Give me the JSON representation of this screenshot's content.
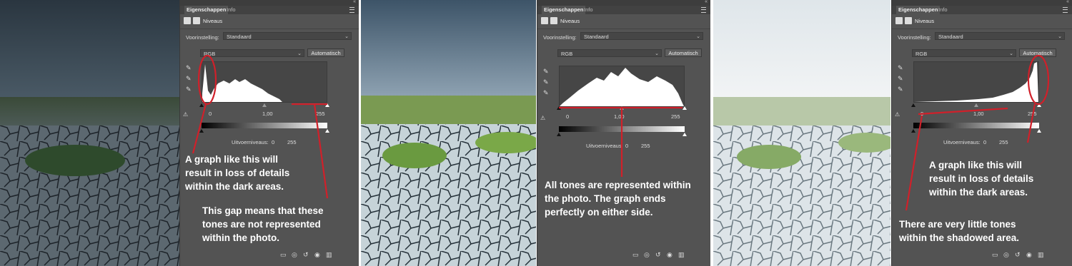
{
  "panels": [
    {
      "tabs": {
        "active": "Eigenschappen",
        "inactive": "Info"
      },
      "adjustment_title": "Niveaus",
      "preset_label": "Voorinstelling:",
      "preset_value": "Standaard",
      "channel_value": "RGB",
      "auto_label": "Automatisch",
      "input_black": "0",
      "input_mid": "1,00",
      "input_white": "255",
      "output_label": "Uitvoerniveaus:",
      "output_black": "0",
      "output_white": "255"
    },
    {
      "tabs": {
        "active": "Eigenschappen",
        "inactive": "Info"
      },
      "adjustment_title": "Niveaus",
      "preset_label": "Voorinstelling:",
      "preset_value": "Standaard",
      "channel_value": "RGB",
      "auto_label": "Automatisch",
      "input_black": "0",
      "input_mid": "1,00",
      "input_white": "255",
      "output_label": "Uitvoerniveaus:",
      "output_black": "0",
      "output_white": "255"
    },
    {
      "tabs": {
        "active": "Eigenschappen",
        "inactive": "Info"
      },
      "adjustment_title": "Niveaus",
      "preset_label": "Voorinstelling:",
      "preset_value": "Standaard",
      "channel_value": "RGB",
      "auto_label": "Automatisch",
      "input_black": "0",
      "input_mid": "1,00",
      "input_white": "255",
      "output_label": "Uitvoerniveaus:",
      "output_black": "0",
      "output_white": "255"
    }
  ],
  "annotations": {
    "a1": [
      "A graph like this will",
      "result in loss of details",
      "within the dark areas."
    ],
    "a2": [
      "This gap means that these",
      "tones are not represented",
      "within the photo."
    ],
    "a3": [
      "All tones are represented within",
      "the photo. The graph ends",
      "perfectly on either side."
    ],
    "a4": [
      "A graph like this will",
      "result in loss of details",
      "within the dark areas."
    ],
    "a5": [
      "There are very little tones",
      "within the shadowed area."
    ]
  },
  "icons": {
    "collapse": "double-chevron-icon",
    "menu": "panel-menu-icon",
    "levels": "levels-icon",
    "mask": "mask-icon",
    "eyedroppers": [
      "black-eyedropper-icon",
      "gray-eyedropper-icon",
      "white-eyedropper-icon"
    ],
    "warning": "clipping-warning-icon",
    "footer": [
      "clip-to-layer-icon",
      "view-previous-icon",
      "reset-icon",
      "visibility-eye-icon",
      "trash-icon"
    ]
  },
  "colors": {
    "annotation_line": "#d0202a",
    "panel_bg": "#535353",
    "annotation_text": "#ffffff"
  }
}
